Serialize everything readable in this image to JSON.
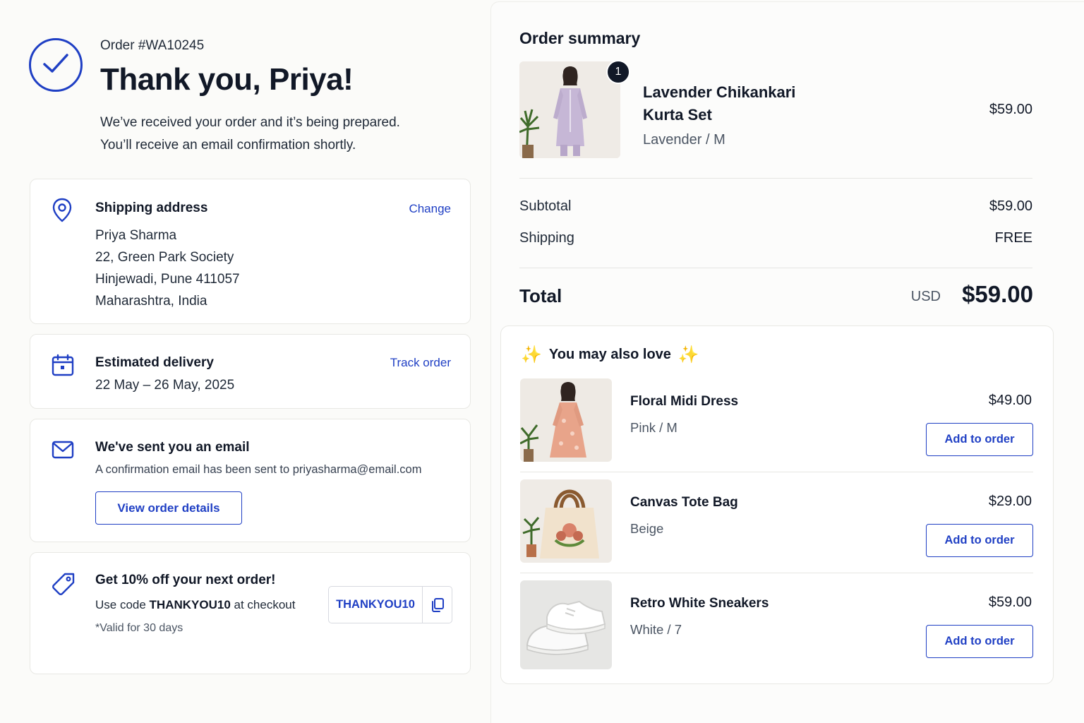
{
  "header": {
    "order_number": "Order #WA10245",
    "title": "Thank you, Priya!",
    "intro_line1": "We’ve received your order and it’s being prepared.",
    "intro_line2": "You’ll receive an email confirmation shortly."
  },
  "shipping": {
    "title": "Shipping address",
    "action": "Change",
    "lines": [
      "Priya Sharma",
      "22, Green Park Society",
      "Hinjewadi, Pune 411057",
      "Maharashtra, India"
    ]
  },
  "delivery": {
    "title": "Estimated delivery",
    "action": "Track order",
    "dates": "22 May – 26 May, 2025"
  },
  "email": {
    "title": "We've sent you an email",
    "text": "A confirmation email has been sent to priyasharma@email.com",
    "button": "View order details"
  },
  "promo": {
    "title": "Get 10% off your next order!",
    "line_prefix": "Use code ",
    "line_code": "THANKYOU10",
    "line_suffix": " at checkout",
    "valid": "*Valid for 30 days",
    "code": "THANKYOU10"
  },
  "summary": {
    "title": "Order summary",
    "item": {
      "quantity": "1",
      "name_line1": "Lavender Chikankari",
      "name_line2": "Kurta Set",
      "variant": "Lavender / M",
      "price": "$59.00"
    },
    "subtotal_label": "Subtotal",
    "subtotal_value": "$59.00",
    "shipping_label": "Shipping",
    "shipping_value": "FREE",
    "total_label": "Total",
    "currency": "USD",
    "total_value": "$59.00"
  },
  "recommendations": {
    "title": "You may also love",
    "sparkle": "✨",
    "items": [
      {
        "name": "Floral Midi Dress",
        "variant": "Pink / M",
        "price": "$49.00",
        "button": "Add to order"
      },
      {
        "name": "Canvas Tote Bag",
        "variant": "Beige",
        "price": "$29.00",
        "button": "Add to order"
      },
      {
        "name": "Retro White Sneakers",
        "variant": "White / 7",
        "price": "$59.00",
        "button": "Add to order"
      }
    ]
  },
  "colors": {
    "accent": "#1f3fc4",
    "text": "#111827",
    "background": "#fbfbf9"
  }
}
